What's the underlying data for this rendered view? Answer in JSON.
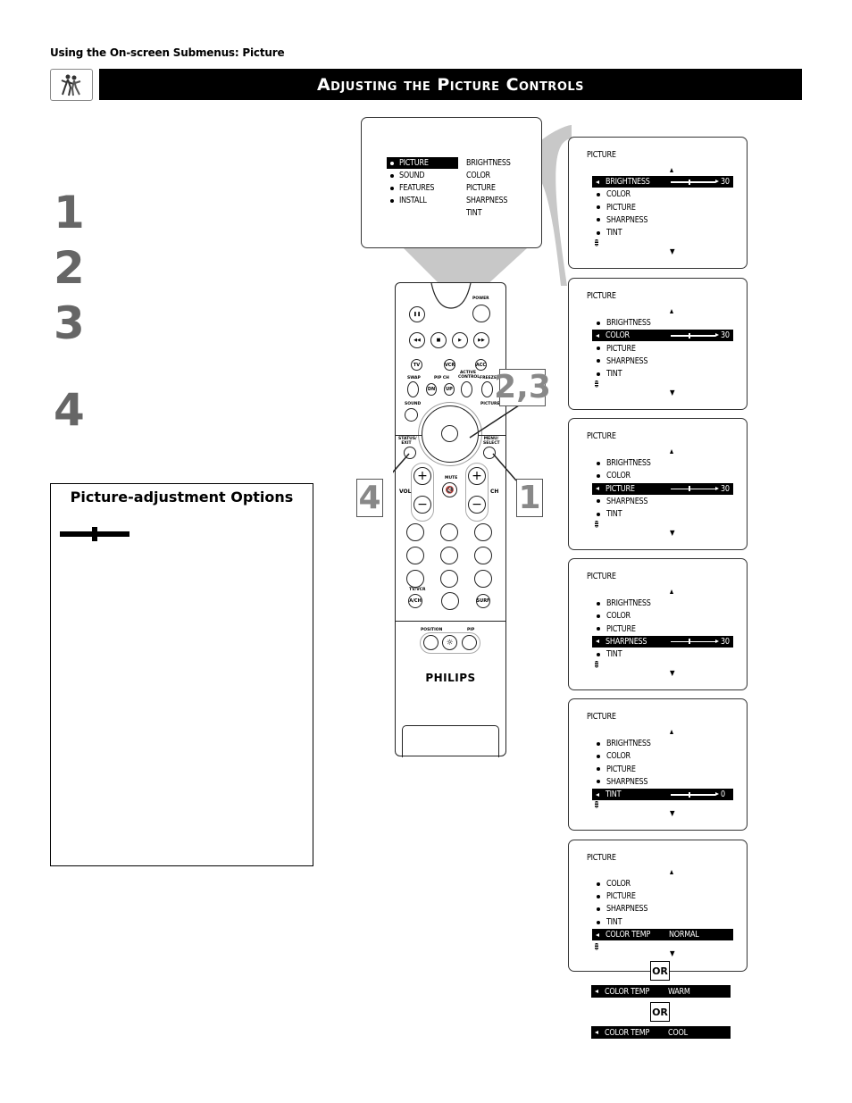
{
  "header": {
    "section_label": "Using the On-screen Submenus: Picture",
    "title": "Adjusting the Picture Controls",
    "logo_icon": "dancers-icon"
  },
  "steps": [
    "1",
    "2",
    "3",
    "4"
  ],
  "options_box": {
    "title": "Picture-adjustment Options",
    "icon": "slider-icon"
  },
  "main_menu": {
    "items": [
      {
        "label": "PICTURE",
        "selected": true
      },
      {
        "label": "SOUND",
        "selected": false
      },
      {
        "label": "FEATURES",
        "selected": false
      },
      {
        "label": "INSTALL",
        "selected": false
      }
    ],
    "submenu": [
      "BRIGHTNESS",
      "COLOR",
      "PICTURE",
      "SHARPNESS",
      "TINT"
    ]
  },
  "screens": [
    {
      "title": "PICTURE",
      "rows": [
        "BRIGHTNESS",
        "COLOR",
        "PICTURE",
        "SHARPNESS",
        "TINT"
      ],
      "selected": 0,
      "value": "30",
      "slider_fraction": 0.4
    },
    {
      "title": "PICTURE",
      "rows": [
        "BRIGHTNESS",
        "COLOR",
        "PICTURE",
        "SHARPNESS",
        "TINT"
      ],
      "selected": 1,
      "value": "30",
      "slider_fraction": 0.4
    },
    {
      "title": "PICTURE",
      "rows": [
        "BRIGHTNESS",
        "COLOR",
        "PICTURE",
        "SHARPNESS",
        "TINT"
      ],
      "selected": 2,
      "value": "30",
      "slider_fraction": 0.4
    },
    {
      "title": "PICTURE",
      "rows": [
        "BRIGHTNESS",
        "COLOR",
        "PICTURE",
        "SHARPNESS",
        "TINT"
      ],
      "selected": 3,
      "value": "30",
      "slider_fraction": 0.4
    },
    {
      "title": "PICTURE",
      "rows": [
        "BRIGHTNESS",
        "COLOR",
        "PICTURE",
        "SHARPNESS",
        "TINT"
      ],
      "selected": 4,
      "value": "0",
      "slider_fraction": 0.5
    }
  ],
  "color_temp_screen": {
    "title": "PICTURE",
    "rows": [
      "COLOR",
      "PICTURE",
      "SHARPNESS",
      "TINT"
    ],
    "selected_label": "COLOR TEMP",
    "options": [
      "NORMAL",
      "WARM",
      "COOL"
    ],
    "or_label": "OR"
  },
  "remote": {
    "brand": "PHILIPS",
    "labels": {
      "power": "POWER",
      "tv": "TV",
      "vcr": "VCR",
      "acc": "ACC",
      "swap": "SWAP",
      "pip_ch": "PIP CH",
      "active_control": "ACTIVE CONTROL",
      "freeze": "FREEZE",
      "dn": "DN",
      "up": "UP",
      "sound": "SOUND",
      "picture": "PICTURE",
      "status_exit": "STATUS/ EXIT",
      "menu_select": "MENU/ SELECT",
      "vol": "VOL",
      "ch": "CH",
      "mute": "MUTE",
      "tv_vcr": "TV/VCR",
      "a_ch": "A/CH",
      "surf": "SURF",
      "position": "POSITION",
      "pip": "PIP"
    }
  },
  "callouts": {
    "menu_nav": "2,3",
    "exit": "4",
    "menu": "1"
  }
}
